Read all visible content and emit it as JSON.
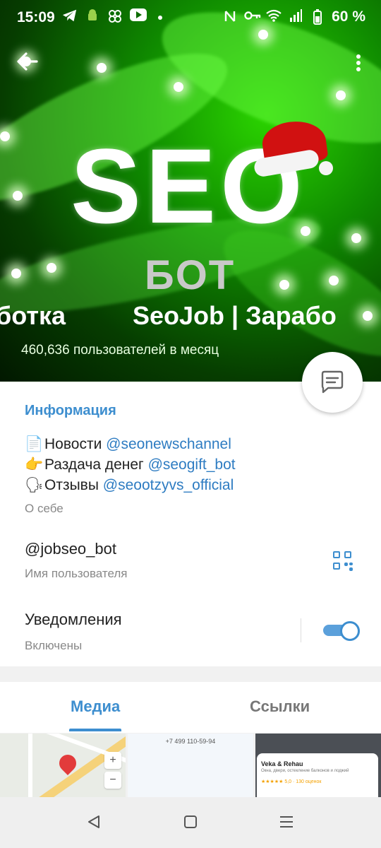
{
  "status_bar": {
    "time": "15:09",
    "battery": "60 %",
    "left_icons": [
      "telegram-icon",
      "android-icon",
      "pinwheel-icon",
      "youtube-icon",
      "dot-icon"
    ],
    "right_icons": [
      "nfc-icon",
      "key-icon",
      "wifi-icon",
      "signal-icon",
      "battery-icon"
    ]
  },
  "header": {
    "cover_text": "SEO",
    "cover_subtext": "БОТ",
    "title_left_fragment": "ботка",
    "title_right_fragment": "SeoJob | Зарабо",
    "subtitle": "460,636 пользователей в месяц"
  },
  "info": {
    "section_title": "Информация",
    "bio": [
      {
        "emoji": "📄",
        "text": "Новости ",
        "link": "@seonewschannel"
      },
      {
        "emoji": "👉",
        "text": "Раздача денег ",
        "link": "@seogift_bot"
      },
      {
        "emoji": "🗣",
        "text": "Отзывы ",
        "link": "@seootzyvs_official"
      }
    ],
    "bio_label": "О себе",
    "username": "@jobseo_bot",
    "username_label": "Имя пользователя",
    "notifications": "Уведомления",
    "notifications_state": "Включены",
    "notifications_on": true
  },
  "tabs": {
    "media": "Медиа",
    "links": "Ссылки",
    "active": "media"
  },
  "media_tiles": {
    "tile2_phone": "+7 499 110-59-94",
    "tile3_title": "Veka & Rehau",
    "tile3_desc": "Окна, двери, остекление балконов и лоджий",
    "tile3_rating": "★★★★★ 5,0 · 130 оценок"
  },
  "colors": {
    "accent": "#3d8ecf",
    "link": "#2e7cc2",
    "hero_green": "#0f8a00"
  }
}
